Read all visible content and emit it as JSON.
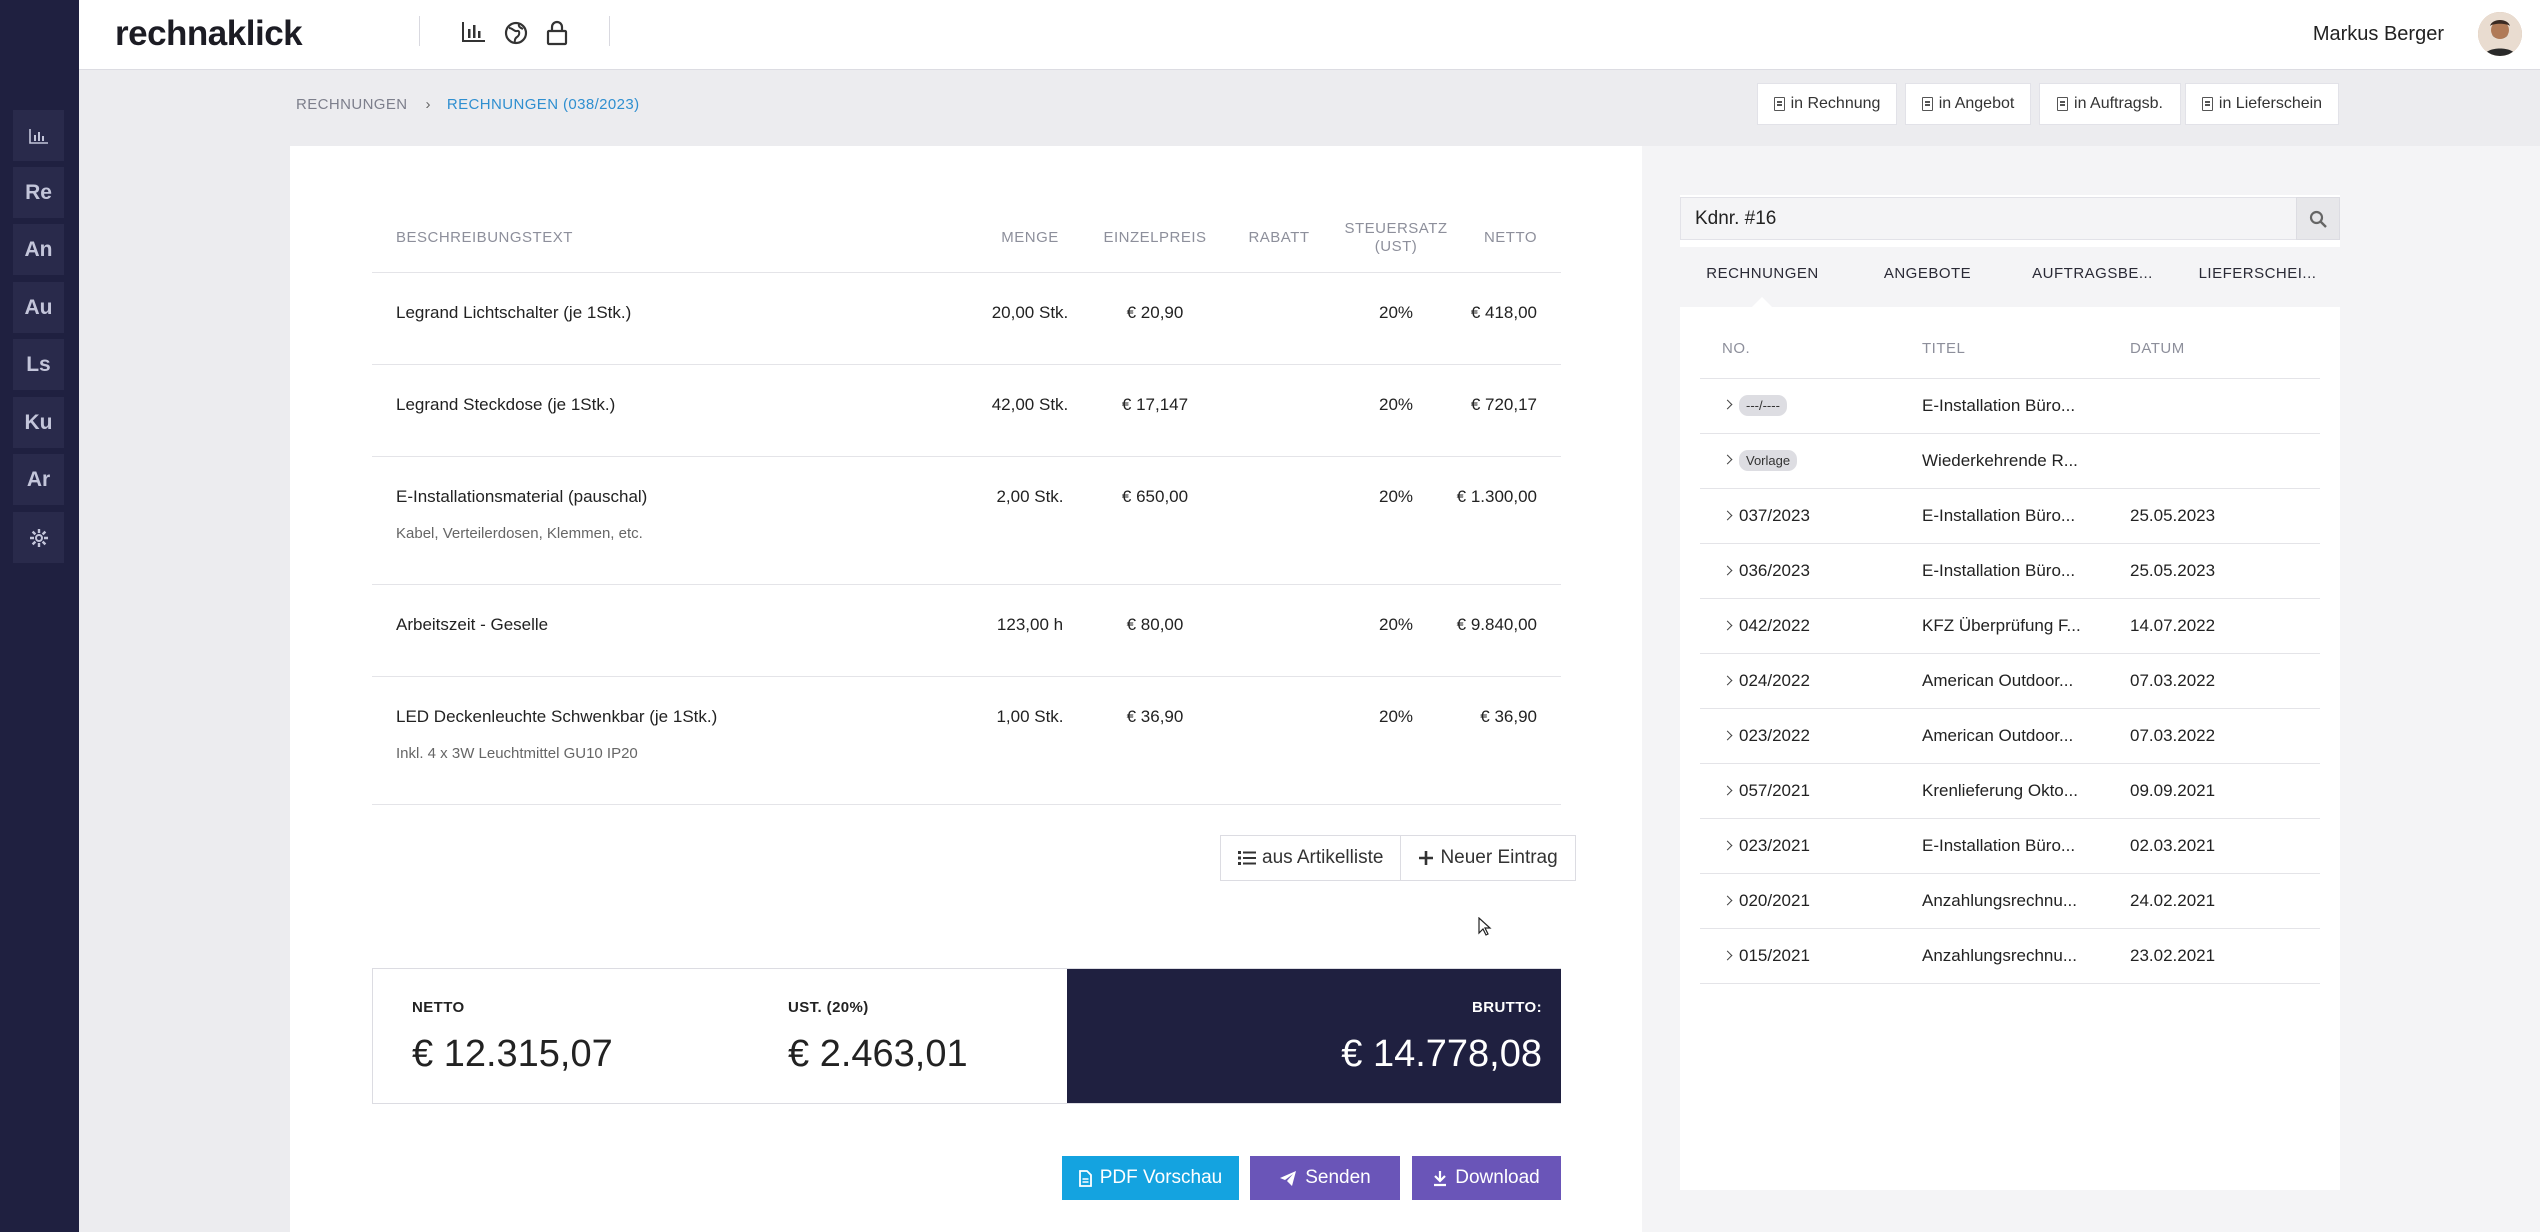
{
  "app": {
    "logo": "rechnaklick",
    "user_name": "Markus Berger"
  },
  "sidebar": [
    {
      "label": "",
      "icon": "bar-chart-icon"
    },
    {
      "label": "Re"
    },
    {
      "label": "An"
    },
    {
      "label": "Au"
    },
    {
      "label": "Ls"
    },
    {
      "label": "Ku"
    },
    {
      "label": "Ar"
    },
    {
      "label": "",
      "icon": "gear-icon"
    }
  ],
  "topbar_icons": [
    "bar-chart-icon",
    "globe-icon",
    "lock-icon"
  ],
  "breadcrumb": {
    "root": "RECHNUNGEN",
    "current": "RECHNUNGEN (038/2023)"
  },
  "convert_buttons": [
    "in Rechnung",
    "in Angebot",
    "in Auftragsb.",
    "in Lieferschein"
  ],
  "items_table": {
    "headers": [
      "BESCHREIBUNGSTEXT",
      "MENGE",
      "EINZELPREIS",
      "RABATT",
      "STEUERSATZ (UST)",
      "NETTO"
    ],
    "rows": [
      {
        "desc": "Legrand Lichtschalter (je 1Stk.)",
        "sub": "",
        "qty": "20,00 Stk.",
        "price": "€ 20,90",
        "discount": "",
        "tax": "20%",
        "net": "€ 418,00"
      },
      {
        "desc": "Legrand Steckdose (je 1Stk.)",
        "sub": "",
        "qty": "42,00 Stk.",
        "price": "€ 17,147",
        "discount": "",
        "tax": "20%",
        "net": "€ 720,17"
      },
      {
        "desc": "E-Installationsmaterial (pauschal)",
        "sub": "Kabel, Verteilerdosen, Klemmen, etc.",
        "qty": "2,00 Stk.",
        "price": "€ 650,00",
        "discount": "",
        "tax": "20%",
        "net": "€ 1.300,00"
      },
      {
        "desc": "Arbeitszeit - Geselle",
        "sub": "",
        "qty": "123,00 h",
        "price": "€ 80,00",
        "discount": "",
        "tax": "20%",
        "net": "€ 9.840,00"
      },
      {
        "desc": "LED Deckenleuchte Schwenkbar (je 1Stk.)",
        "sub": "Inkl. 4 x 3W Leuchtmittel GU10 IP20",
        "qty": "1,00 Stk.",
        "price": "€ 36,90",
        "discount": "",
        "tax": "20%",
        "net": "€ 36,90"
      }
    ]
  },
  "table_actions": {
    "from_list": "aus Artikelliste",
    "new_entry": "Neuer Eintrag"
  },
  "totals": {
    "net_label": "NETTO",
    "net_value": "€ 12.315,07",
    "vat_label": "UST. (20%)",
    "vat_value": "€ 2.463,01",
    "gross_label": "BRUTTO:",
    "gross_value": "€ 14.778,08"
  },
  "actions": {
    "pdf": "PDF Vorschau",
    "send": "Senden",
    "download": "Download"
  },
  "colors": {
    "sidebar": "#1f2040",
    "pdf": "#14a3e0",
    "purple": "#6a55b8",
    "link": "#2f8fd0"
  },
  "right_panel": {
    "search_value": "Kdnr. #16",
    "tabs": [
      "RECHNUNGEN",
      "ANGEBOTE",
      "AUFTRAGSBE...",
      "LIEFERSCHEI..."
    ],
    "headers": [
      "NO.",
      "TITEL",
      "DATUM"
    ],
    "rows": [
      {
        "no": "---/----",
        "pill": true,
        "title": "E-Installation Büro...",
        "date": ""
      },
      {
        "no": "Vorlage",
        "pill": true,
        "title": "Wiederkehrende R...",
        "date": ""
      },
      {
        "no": "037/2023",
        "title": "E-Installation Büro...",
        "date": "25.05.2023"
      },
      {
        "no": "036/2023",
        "title": "E-Installation Büro...",
        "date": "25.05.2023"
      },
      {
        "no": "042/2022",
        "title": "KFZ Überprüfung F...",
        "date": "14.07.2022"
      },
      {
        "no": "024/2022",
        "title": "American Outdoor...",
        "date": "07.03.2022"
      },
      {
        "no": "023/2022",
        "title": "American Outdoor...",
        "date": "07.03.2022"
      },
      {
        "no": "057/2021",
        "title": "Krenlieferung Okto...",
        "date": "09.09.2021"
      },
      {
        "no": "023/2021",
        "title": "E-Installation Büro...",
        "date": "02.03.2021"
      },
      {
        "no": "020/2021",
        "title": "Anzahlungsrechnu...",
        "date": "24.02.2021"
      },
      {
        "no": "015/2021",
        "title": "Anzahlungsrechnu...",
        "date": "23.02.2021"
      }
    ]
  }
}
